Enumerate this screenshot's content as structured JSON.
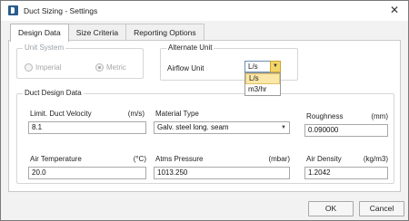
{
  "window": {
    "title": "Duct Sizing - Settings",
    "close_glyph": "✕"
  },
  "tabs": [
    {
      "label": "Design Data"
    },
    {
      "label": "Size Criteria"
    },
    {
      "label": "Reporting Options"
    }
  ],
  "unit_system": {
    "legend": "Unit System",
    "options": [
      {
        "label": "Imperial",
        "checked": false
      },
      {
        "label": "Metric",
        "checked": true
      }
    ]
  },
  "alternate_unit": {
    "legend": "Alternate Unit",
    "airflow_label": "Airflow Unit",
    "airflow_value": "L/s",
    "dropdown_options": [
      "L/s",
      "m3/hr"
    ],
    "selected_option": "L/s"
  },
  "duct_design": {
    "legend": "Duct Design Data",
    "limit_velocity": {
      "label": "Limit. Duct Velocity",
      "unit": "(m/s)",
      "value": "8.1"
    },
    "material_type": {
      "label": "Material Type",
      "value": "Galv. steel long. seam"
    },
    "roughness": {
      "label": "Roughness",
      "unit": "(mm)",
      "value": "0.090000"
    },
    "air_temperature": {
      "label": "Air Temperature",
      "unit": "(°C)",
      "value": "20.0"
    },
    "atms_pressure": {
      "label": "Atms Pressure",
      "unit": "(mbar)",
      "value": "1013.250"
    },
    "air_density": {
      "label": "Air Density",
      "unit": "(kg/m3)",
      "value": "1.2042"
    }
  },
  "buttons": {
    "ok": "OK",
    "cancel": "Cancel"
  },
  "colors": {
    "dropdown_highlight": "#fbe7a8",
    "dropdown_button": "#f3d56a"
  }
}
